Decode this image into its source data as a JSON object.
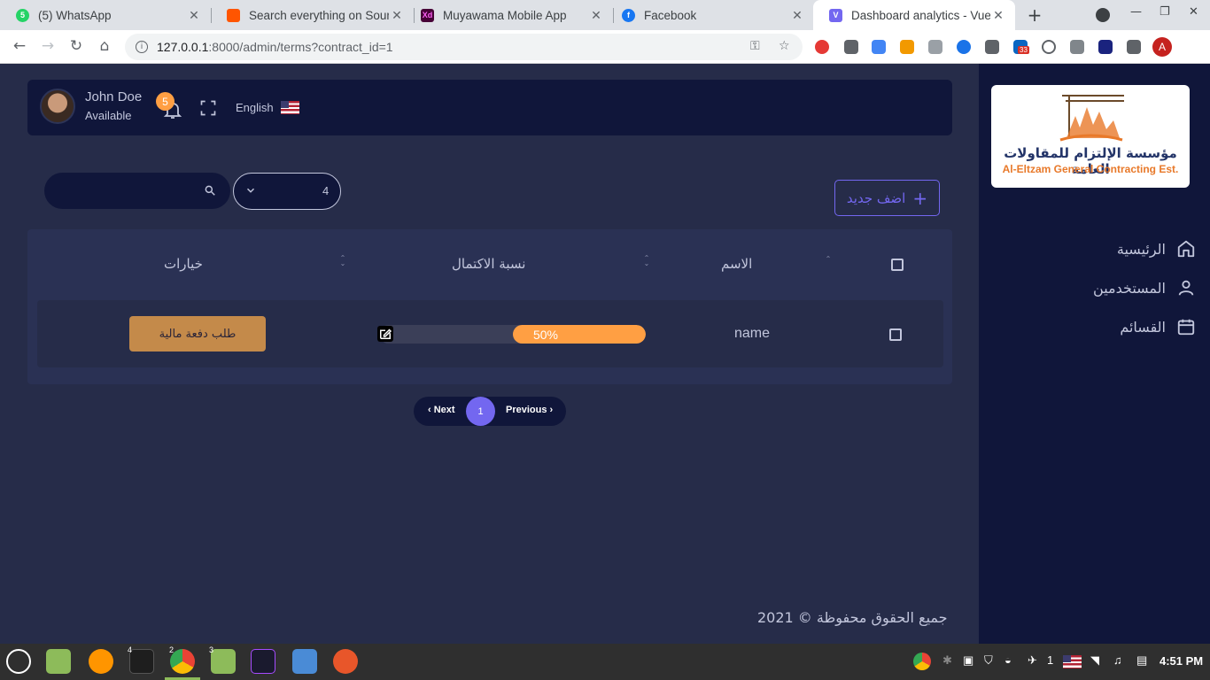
{
  "browser": {
    "tabs": [
      {
        "title": "(5) WhatsApp",
        "active": false
      },
      {
        "title": "Search everything on Sound",
        "active": false
      },
      {
        "title": "Muyawama Mobile App",
        "active": false
      },
      {
        "title": "Facebook",
        "active": false
      },
      {
        "title": "Dashboard analytics - Vuexy",
        "active": true
      }
    ],
    "url_host": "127.0.0.1",
    "url_rest": ":8000/admin/terms?contract_id=1",
    "profile_initial": "A",
    "ext_badge": "33"
  },
  "sidebar": {
    "logo_ar": "مؤسسة الإلتزام للمقاولات العامة",
    "logo_en": "Al-Eltzam General Contracting Est.",
    "items": [
      {
        "label": "الرئيسية",
        "icon": "home-icon"
      },
      {
        "label": "المستخدمين",
        "icon": "user-icon"
      },
      {
        "label": "القسائم",
        "icon": "calendar-icon"
      }
    ]
  },
  "topnav": {
    "user_name": "John Doe",
    "user_status": "Available",
    "notif_count": "5",
    "language": "English"
  },
  "controls": {
    "search_placeholder": "",
    "per_page": "4",
    "add_label": "اضف جديد"
  },
  "table": {
    "headers": [
      "الاسم",
      "نسبة الاكتمال",
      "خيارات"
    ],
    "rows": [
      {
        "name": "name",
        "progress": 0.5,
        "progress_label": "50%",
        "action_label": "طلب دفعة مالية"
      }
    ]
  },
  "pagination": {
    "next_label": "Next",
    "current_page": "1",
    "prev_label": "Previous"
  },
  "footer": {
    "text": "2021 © جميع الحقوق محفوظة"
  },
  "taskbar": {
    "clock": "4:51 PM",
    "workspace_num": "1",
    "chrome_windows": "2",
    "terminal_windows": "4",
    "files_windows": "3"
  },
  "colors": {
    "accent": "#7367f0",
    "warning": "#ff9f43",
    "sidebar_bg": "#10163a",
    "content_bg": "#262c49"
  }
}
